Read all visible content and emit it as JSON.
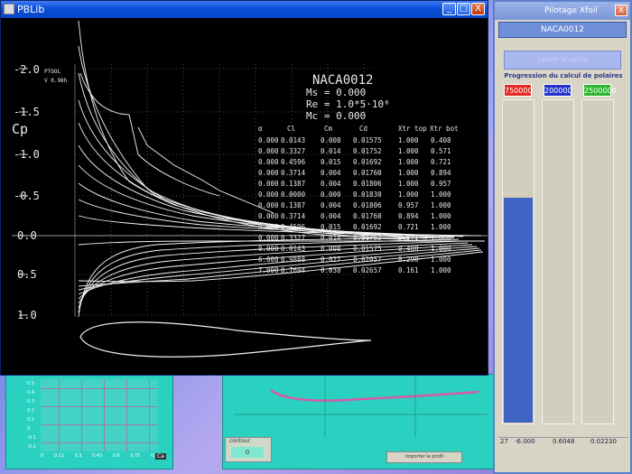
{
  "main_window": {
    "title": "PBLib",
    "controls": {
      "minimize": "_",
      "maximize": "□",
      "close": "X"
    }
  },
  "plot": {
    "airfoil": "NACA0012",
    "ms_line": "Ms = 0.000",
    "re_line": "Re = 1.0*5·10⁶",
    "mc_line": "Mc = 0.000",
    "small_label_1": "PTOOL",
    "small_label_2": "V 0.98h",
    "y_axis_label": "Cp",
    "y_ticks": [
      "-2.0",
      "-1.5",
      "-1.0",
      "-0.5",
      "0.0",
      "0.5",
      "1.0"
    ],
    "table_headers": [
      "α",
      "Cl",
      "Cm",
      "Cd",
      "Xtr top",
      "Xtr bot"
    ],
    "table_rows": [
      [
        "0.000",
        "0.0143",
        "0.008",
        "0.01575",
        "1.000",
        "0.408"
      ],
      [
        "0.000",
        "0.3327",
        "0.014",
        "0.01752",
        "1.000",
        "0.571"
      ],
      [
        "0.000",
        "0.4596",
        "0.015",
        "0.01692",
        "1.000",
        "0.721"
      ],
      [
        "0.000",
        "0.3714",
        "0.004",
        "0.01760",
        "1.000",
        "0.894"
      ],
      [
        "0.000",
        "0.1387",
        "0.004",
        "0.01806",
        "1.000",
        "0.957"
      ],
      [
        "0.000",
        "0.0000",
        "0.000",
        "0.01830",
        "1.000",
        "1.000"
      ],
      [
        "0.000",
        "0.1387",
        "0.004",
        "0.01806",
        "0.957",
        "1.000"
      ],
      [
        "0.000",
        "0.3714",
        "0.004",
        "0.01760",
        "0.894",
        "1.000"
      ],
      [
        "0.000",
        "0.4596",
        "0.015",
        "0.01692",
        "0.721",
        "1.000"
      ],
      [
        "0.000",
        "0.3327",
        "0.014",
        "0.01752",
        "0.571",
        "1.000"
      ],
      [
        "0.000",
        "0.0143",
        "0.008",
        "0.01575",
        "0.408",
        "1.000"
      ],
      [
        "6.000",
        "0.9888",
        "0.027",
        "0.02057",
        "0.298",
        "1.000"
      ],
      [
        "7.000",
        "0.7694",
        "0.038",
        "0.02657",
        "0.161",
        "1.000"
      ]
    ]
  },
  "sidebar": {
    "title": "Pilotage Xfoil",
    "airfoil_name": "NACA0012",
    "launch_button": "Lancer le calcul",
    "progress_label": "Progression du calcul de polaires",
    "re_badges": [
      {
        "label": "750000",
        "color": "#e02b24"
      },
      {
        "label": "200000",
        "color": "#2233cc"
      },
      {
        "label": "2500000",
        "color": "#2bb52b"
      }
    ],
    "progress": [
      0.7,
      0,
      0
    ],
    "status": {
      "index": "27",
      "alpha": "-6.000",
      "cl": "0.6048",
      "cd": "0.02230"
    }
  },
  "bottom": {
    "small_chart_y_ticks": [
      "0.5",
      "0.4",
      "0.3",
      "0.2",
      "0.1",
      "0",
      "-0.1",
      "-0.2"
    ],
    "small_chart_x_ticks": [
      "0",
      "0.12",
      "0.3",
      "0.45",
      "0.6",
      "0.75",
      "0.9"
    ],
    "small_chart_axis": "Ca",
    "contour_label": "contour",
    "contour_value": "0",
    "bottom_button": "Importer le profil"
  }
}
